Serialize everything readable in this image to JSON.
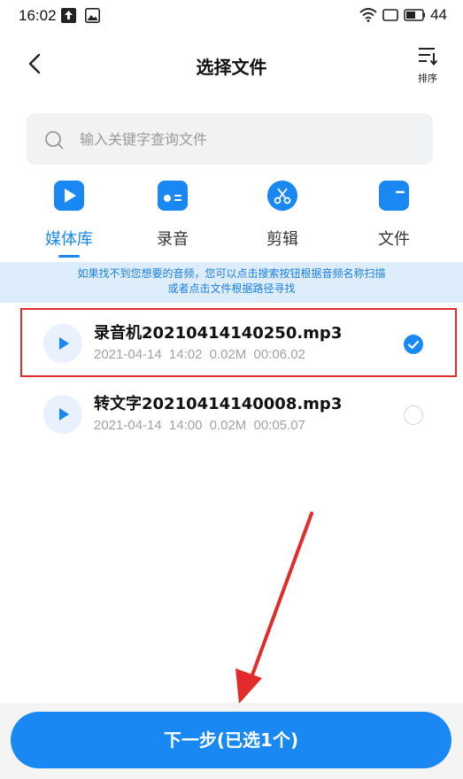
{
  "status_bar": {
    "time": "16:02",
    "battery": "44",
    "icons": [
      "upload-notification-icon",
      "image-notification-icon",
      "wifi-icon",
      "screen-icon",
      "battery-icon"
    ]
  },
  "header": {
    "title": "选择文件",
    "sort_label": "排序",
    "back_icon": "chevron-left-icon",
    "sort_icon": "sort-icon"
  },
  "search": {
    "placeholder": "输入关键字查询文件",
    "icon": "search-icon"
  },
  "tabs": [
    {
      "label": "媒体库",
      "icon": "play-icon",
      "active": true
    },
    {
      "label": "录音",
      "icon": "radio-icon",
      "active": false
    },
    {
      "label": "剪辑",
      "icon": "scissors-icon",
      "active": false
    },
    {
      "label": "文件",
      "icon": "folder-icon",
      "active": false
    }
  ],
  "tip": {
    "line1": "如果找不到您想要的音频，您可以点击搜索按钮根据音频名称扫描",
    "line2": "或者点击文件根据路径寻找"
  },
  "files": [
    {
      "name": "录音机20210414140250.mp3",
      "date": "2021-04-14 14:02",
      "size": "0.02M",
      "duration": "00:06.02",
      "selected": true
    },
    {
      "name": "转文字20210414140008.mp3",
      "date": "2021-04-14 14:00",
      "size": "0.02M",
      "duration": "00:05.07",
      "selected": false
    }
  ],
  "footer": {
    "next_label": "下一步(已选1个)"
  },
  "colors": {
    "accent": "#1a88f2",
    "tip_background": "#deedfc",
    "annotation_red": "#e22b2b"
  }
}
